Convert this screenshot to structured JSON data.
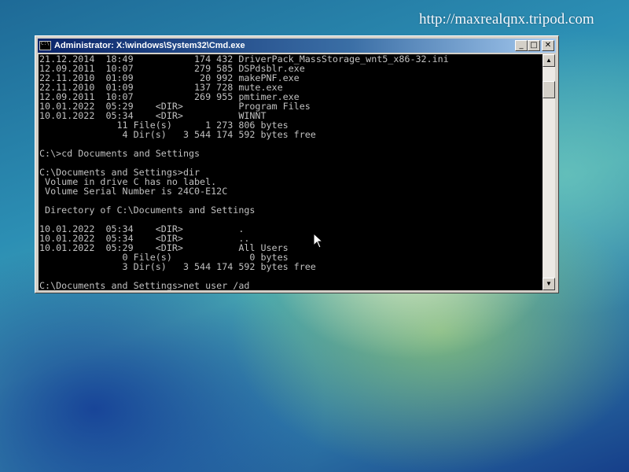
{
  "watermark": "http://maxrealqnx.tripod.com",
  "window": {
    "title": "Administrator: X:\\windows\\System32\\Cmd.exe",
    "icon": "cmd-icon",
    "buttons": {
      "minimize": "_",
      "maximize": "□",
      "close": "✕"
    }
  },
  "console": {
    "lines": [
      "21.12.2014  18:49           174 432 DriverPack_MassStorage_wnt5_x86-32.ini",
      "12.09.2011  10:07           279 585 DSPdsblr.exe",
      "22.11.2010  01:09            20 992 makePNF.exe",
      "22.11.2010  01:09           137 728 mute.exe",
      "12.09.2011  10:07           269 955 pmtimer.exe",
      "10.01.2022  05:29    <DIR>          Program Files",
      "10.01.2022  05:34    <DIR>          WINNT",
      "              11 File(s)      1 273 806 bytes",
      "               4 Dir(s)   3 544 174 592 bytes free",
      "",
      "C:\\>cd Documents and Settings",
      "",
      "C:\\Documents and Settings>dir",
      " Volume in drive C has no label.",
      " Volume Serial Number is 24C0-E12C",
      "",
      " Directory of C:\\Documents and Settings",
      "",
      "10.01.2022  05:34    <DIR>          .",
      "10.01.2022  05:34    <DIR>          ..",
      "10.01.2022  05:29    <DIR>          All Users",
      "               0 File(s)              0 bytes",
      "               3 Dir(s)   3 544 174 592 bytes free",
      "",
      "C:\\Documents and Settings>net user /ad"
    ]
  },
  "scrollbar": {
    "up_icon": "▲",
    "down_icon": "▼"
  }
}
